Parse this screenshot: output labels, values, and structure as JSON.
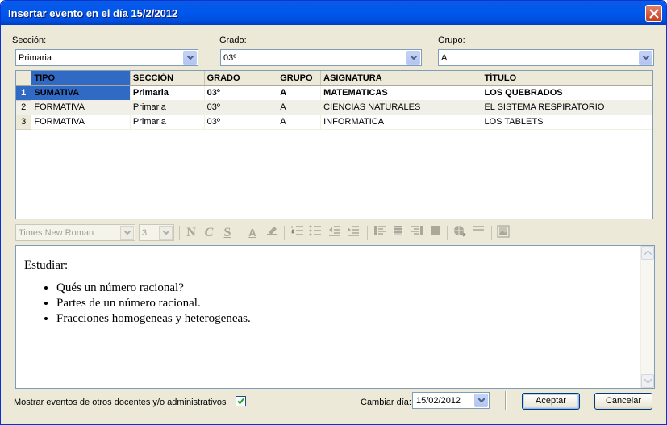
{
  "window": {
    "title": "Insertar evento en el día 15/2/2012"
  },
  "filters": {
    "seccion": {
      "label": "Sección:",
      "value": "Primaria"
    },
    "grado": {
      "label": "Grado:",
      "value": "03º"
    },
    "grupo": {
      "label": "Grupo:",
      "value": "A"
    }
  },
  "table": {
    "columns": [
      "TIPO",
      "SECCIÓN",
      "GRADO",
      "GRUPO",
      "ASIGNATURA",
      "TÍTULO"
    ],
    "rows": [
      {
        "num": "1",
        "tipo": "SUMATIVA",
        "seccion": "Primaria",
        "grado": "03º",
        "grupo": "A",
        "asignatura": "MATEMATICAS",
        "titulo": "LOS QUEBRADOS"
      },
      {
        "num": "2",
        "tipo": "FORMATIVA",
        "seccion": "Primaria",
        "grado": "03º",
        "grupo": "A",
        "asignatura": "CIENCIAS NATURALES",
        "titulo": "EL SISTEMA RESPIRATORIO"
      },
      {
        "num": "3",
        "tipo": "FORMATIVA",
        "seccion": "Primaria",
        "grado": "03º",
        "grupo": "A",
        "asignatura": "INFORMATICA",
        "titulo": "LOS TABLETS"
      }
    ]
  },
  "toolbar": {
    "font_name": "Times New Roman",
    "font_size": "3",
    "bold_label": "N",
    "italic_label": "C",
    "underline_label": "S",
    "font_color_label": "A"
  },
  "editor": {
    "heading": "Estudiar:",
    "items": [
      "Qués un número racional?",
      "Partes de un número racional.",
      "Fracciones homogeneas y heterogeneas."
    ]
  },
  "footer": {
    "show_others_label": "Mostrar eventos de otros docentes y/o administrativos",
    "show_others_checked": true,
    "change_day_label": "Cambiar día:",
    "date_value": "15/02/2012",
    "accept_label": "Aceptar",
    "cancel_label": "Cancelar"
  }
}
